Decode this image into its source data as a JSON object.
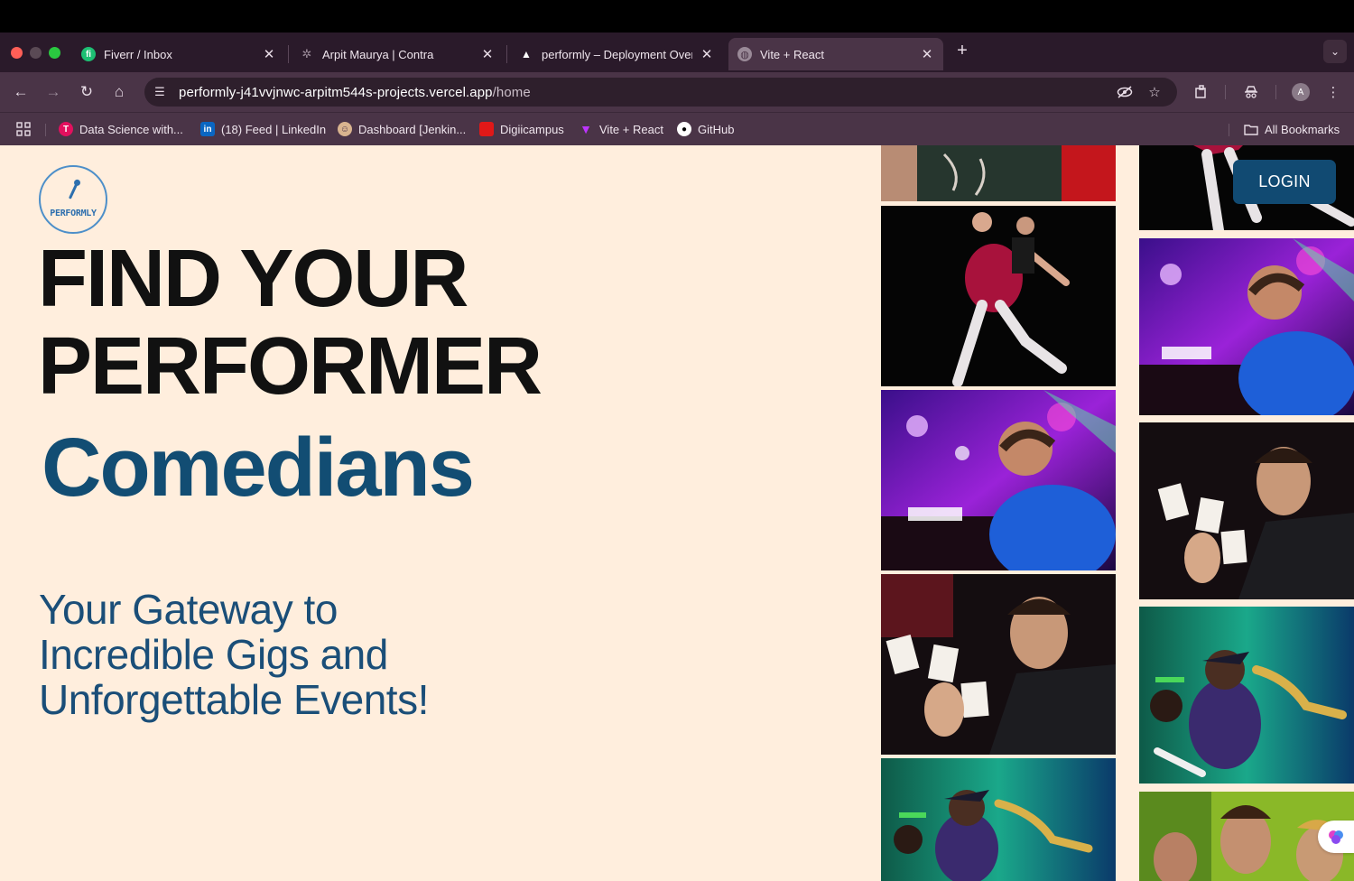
{
  "browser": {
    "tabs": [
      {
        "title": "Fiverr / Inbox",
        "active": false
      },
      {
        "title": "Arpit Maurya | Contra",
        "active": false
      },
      {
        "title": "performly – Deployment Over",
        "active": false
      },
      {
        "title": "Vite + React",
        "active": true
      }
    ],
    "address": {
      "host": "performly-j41vvjnwc-arpitm544s-projects.vercel.app",
      "path": "/home"
    },
    "profile_initial": "A",
    "bookmarks": [
      {
        "label": "Data Science with..."
      },
      {
        "label": "(18) Feed | LinkedIn"
      },
      {
        "label": "Dashboard [Jenkin..."
      },
      {
        "label": "Digiicampus"
      },
      {
        "label": "Vite + React"
      },
      {
        "label": "GitHub"
      }
    ],
    "all_bookmarks": "All Bookmarks"
  },
  "page": {
    "logo_text": "PERFORMLY",
    "hero": {
      "line1": "FIND YOUR",
      "line2": "PERFORMER",
      "rotating_word": "Comedians",
      "subtitle": "Your Gateway to Incredible Gigs and Unforgettable Events!"
    },
    "login_label": "LOGIN"
  },
  "colors": {
    "page_bg": "#ffeedd",
    "accent": "#124d73",
    "chrome": "#4a3447"
  }
}
